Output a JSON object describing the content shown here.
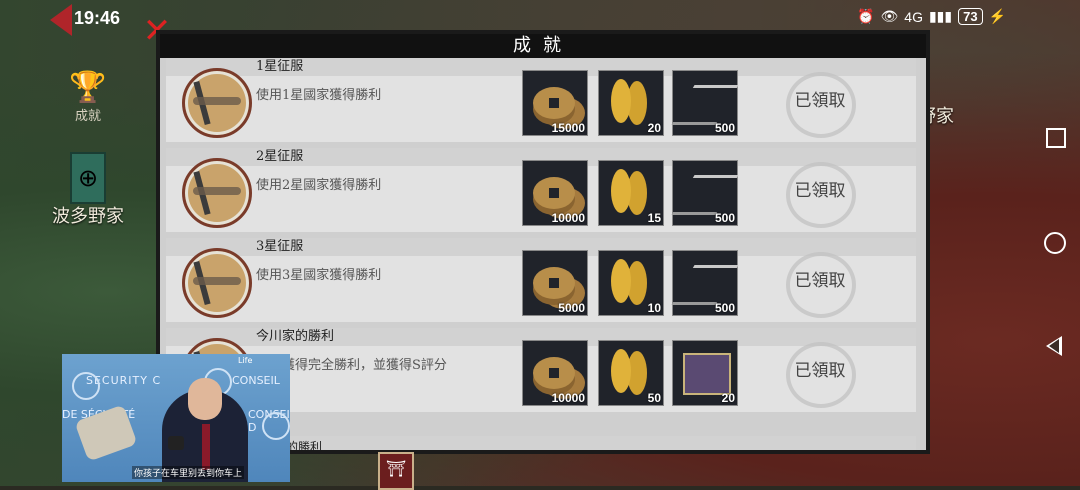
{
  "status": {
    "time": "19:46",
    "battery": "73",
    "network": "4G"
  },
  "panel": {
    "title": "成就"
  },
  "left": {
    "trophy_label": "成就",
    "clan_name": "波多野家"
  },
  "right": {
    "partial_name": "野家"
  },
  "achievements": [
    {
      "title": "1星征服",
      "desc": "使用1星國家獲得勝利",
      "items": [
        {
          "icon": "coin-icon",
          "qty": "15000"
        },
        {
          "icon": "gold-bar-icon",
          "qty": "20"
        },
        {
          "icon": "nails-icon",
          "qty": "500"
        }
      ],
      "claim": "已領取"
    },
    {
      "title": "2星征服",
      "desc": "使用2星國家獲得勝利",
      "items": [
        {
          "icon": "coin-icon",
          "qty": "10000"
        },
        {
          "icon": "gold-bar-icon",
          "qty": "15"
        },
        {
          "icon": "nails-icon",
          "qty": "500"
        }
      ],
      "claim": "已領取"
    },
    {
      "title": "3星征服",
      "desc": "使用3星國家獲得勝利",
      "items": [
        {
          "icon": "coin-icon",
          "qty": "5000"
        },
        {
          "icon": "gold-bar-icon",
          "qty": "10"
        },
        {
          "icon": "nails-icon",
          "qty": "500"
        }
      ],
      "claim": "已領取"
    },
    {
      "title": "今川家的勝利",
      "desc": "川家獲得完全勝利，並獲得S評分",
      "items": [
        {
          "icon": "coin-icon",
          "qty": "10000"
        },
        {
          "icon": "gold-bar-icon",
          "qty": "50"
        },
        {
          "icon": "book-icon",
          "qty": "20"
        }
      ],
      "claim": "已領取"
    }
  ],
  "partial_row": {
    "title": "的勝利"
  },
  "pip": {
    "bg_text_1": "SECURITY C",
    "bg_text_2": "CONSEIL",
    "bg_text_3": "DE SÉCURITÉ",
    "bg_text_4": "CONSEIL D",
    "subtitle": "你孩子在车里别丢到你车上",
    "tiny_label": "Life"
  }
}
